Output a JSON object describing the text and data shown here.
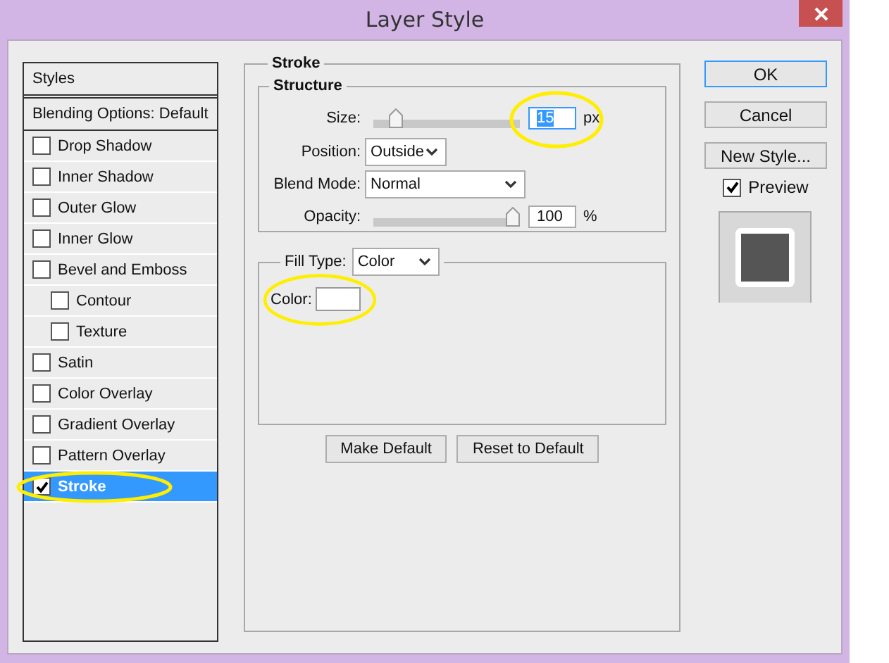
{
  "window": {
    "title": "Layer Style"
  },
  "styles_panel": {
    "header": "Styles",
    "blending": "Blending Options: Default",
    "items": [
      {
        "label": "Drop Shadow",
        "checked": false,
        "selected": false,
        "highlighted": false
      },
      {
        "label": "Inner Shadow",
        "checked": false,
        "selected": false,
        "highlighted": false
      },
      {
        "label": "Outer Glow",
        "checked": false,
        "selected": false,
        "highlighted": false
      },
      {
        "label": "Inner Glow",
        "checked": false,
        "selected": false,
        "highlighted": false
      },
      {
        "label": "Bevel and Emboss",
        "checked": false,
        "selected": false,
        "highlighted": false,
        "children": [
          {
            "label": "Contour",
            "checked": false,
            "selected": false,
            "highlighted": false
          },
          {
            "label": "Texture",
            "checked": false,
            "selected": false,
            "highlighted": false
          }
        ]
      },
      {
        "label": "Satin",
        "checked": false,
        "selected": false,
        "highlighted": false
      },
      {
        "label": "Color Overlay",
        "checked": false,
        "selected": false,
        "highlighted": false
      },
      {
        "label": "Gradient Overlay",
        "checked": false,
        "selected": false,
        "highlighted": false
      },
      {
        "label": "Pattern Overlay",
        "checked": false,
        "selected": false,
        "highlighted": false
      },
      {
        "label": "Stroke",
        "checked": true,
        "selected": true,
        "highlighted": true
      }
    ]
  },
  "stroke": {
    "title": "Stroke",
    "structure": {
      "title": "Structure",
      "size": {
        "label": "Size:",
        "level": 0.12,
        "value": "15",
        "text_selected": true,
        "unit": "px",
        "highlighted": true
      },
      "position": {
        "label": "Position:",
        "value": "Outside"
      },
      "blend_mode": {
        "label": "Blend Mode:",
        "value": "Normal"
      },
      "opacity": {
        "label": "Opacity:",
        "level": 1,
        "value": "100",
        "unit": "%"
      }
    },
    "fill": {
      "label": "Fill Type:",
      "value": "Color",
      "color_label": "Color:",
      "color": "#ffffff",
      "highlighted": true
    },
    "buttons": [
      "Make Default",
      "Reset to Default"
    ]
  },
  "actions": [
    {
      "label": "OK",
      "focused": true
    },
    {
      "label": "Cancel",
      "focused": false
    },
    {
      "label": "New Style...",
      "focused": false
    }
  ],
  "preview": {
    "label": "Preview",
    "checked": true
  }
}
